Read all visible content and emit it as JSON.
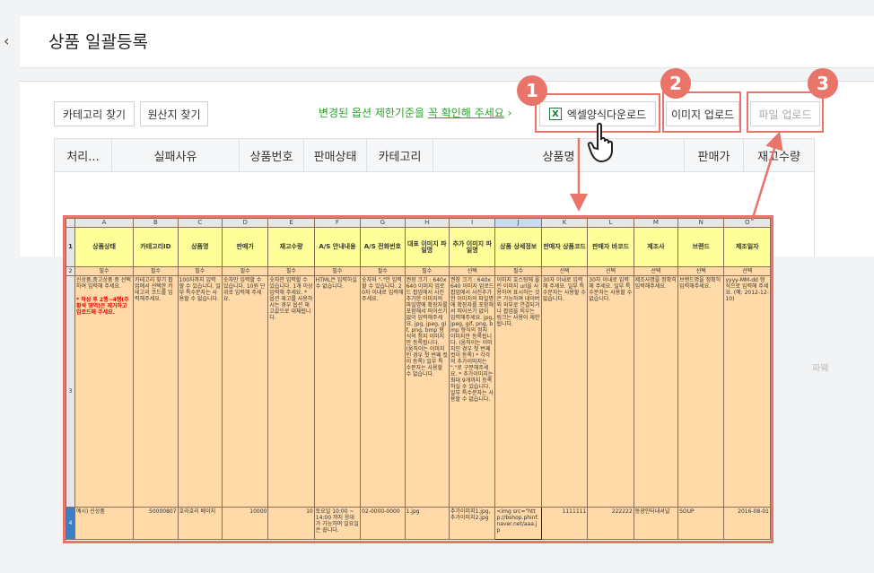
{
  "header": {
    "back_glyph": "‹",
    "title": "상품 일괄등록"
  },
  "toolbar": {
    "category_btn": "카테고리 찾기",
    "origin_btn": "원산지 찾기",
    "notice_pre": "변경된 옵션 제한기준을 ",
    "notice_link": "꼭 확인해 주세요",
    "notice_post": " ›",
    "excel_icon": "X",
    "excel_btn": "엑셀양식다운로드",
    "image_btn": "이미지 업로드",
    "file_btn": "파일 업로드"
  },
  "badges": [
    "1",
    "2",
    "3"
  ],
  "grid": {
    "columns": [
      "처리...",
      "실패사유",
      "상품번호",
      "판매상태",
      "카테고리",
      "상품명",
      "판매가",
      "재고수량"
    ]
  },
  "watermark": "파웨",
  "sheet": {
    "col_letters": [
      "A",
      "B",
      "C",
      "D",
      "E",
      "F",
      "G",
      "H",
      "I",
      "J",
      "K",
      "L",
      "M",
      "N",
      "O"
    ],
    "row_numbers": [
      "1",
      "2",
      "3",
      "4"
    ],
    "headers": [
      "상품상태",
      "카테고리ID",
      "상품명",
      "판매가",
      "재고수량",
      "A/S 안내내용",
      "A/S 전화번호",
      "대표 이미지 파일명",
      "추가 이미지 파일명",
      "상품 상세정보",
      "판매자 상품코드",
      "판매자 바코드",
      "제조사",
      "브랜드",
      "제조일자"
    ],
    "required": [
      "필수",
      "필수",
      "필수",
      "필수",
      "필수",
      "필수",
      "필수",
      "필수",
      "선택",
      "필수",
      "선택",
      "선택",
      "선택",
      "선택",
      "선택"
    ],
    "descriptions": [
      "신상품,중고상품 중 선택하여 입력해 주세요.",
      "카테고리 찾기 팝업에서 선택한 카테고리 코드를 입력해주세요.",
      "100자까지 입력할 수 있습니다. 일부 특수문자는 사용할 수 없습니다.",
      "숫자만 입력할 수 있습니다. 10원 단위로 입력해 주세요.",
      "숫자만 입력할 수 있습니다. 1개 이상 입력해 주세요. * 옵션 재고를 사용하시는 경우 옵션 재고값으로 대체됩니다.",
      "HTML은 입력하실 수 없습니다.",
      "숫자와 \"-\"만 입력할 수 있습니다. 20자 이내로 입력해 주세요.",
      "권장 크기 : 640x640 이미지 업로드 팝업에서 사진추가한 이미지의 파일명에 확장자를 포함해서 띄어쓰기 없이 입력해주세요. jpg, jpeg, gif, png, bmp 형식의 정지 이미지만 등록됩니다. (움직이는 이미지인 경우 첫 번째 컷이 등록) 일부 특수문자는 사용할 수 없습니다.",
      "권장 크기 : 640x640 이미지 업로드 팝업에서 사진추가한 이미지의 파일명에 확장자를 포함해서 띄어쓰기 없이 입력해주세요. jpg, jpeg, gif, png, bmp 형식의 정지 이미지만 등록됩니다. (움직이는 이미지인 경우 첫 번째 컷이 등록) * 각각의 추가이미지는 \",\"로 구분해주세요. * 추가이미지는 최대 9개까지 등록하실 수 있습니다. 일부 특수문자는 사용할 수 없습니다.",
      "이미지 호스팅에 올린 이미지 url을 사용하여 표시하는 것은 가능하며 네이버 외 외부로 연결되거나 팝업을 띄우는 링크는 사용이 제한됩니다.",
      "30자 이내로 입력해 주세요. 일부 특수문자는 사용할 수 없습니다.",
      "30자 이내로 입력해 주세요. 일부 특수문자는 사용할 수 없습니다.",
      "제조사명을 정확히 입력해주세요.",
      "브랜드명을 정확히 입력해주세요.",
      "yyyy-MM-dd 형식으로 입력해 주세요. (예: 2012-12-10)"
    ],
    "desc_red_note": "* 작성 후 2행~4행(주황색 영역)은 제거하고 업로드해 주세요.",
    "examples": [
      "예시) 신상품",
      "50000807",
      "호리호리 베이지",
      "10000",
      "10",
      "토요일 10:00 ~ 14:00 까지 응대가 가능하며 일요일은 쉽니다.",
      "02-0000-0000",
      "1.jpg",
      "추가이미지1.jpg, 추가이미지2.jpg",
      "<img src=\"http://bshop.phinf.naver.net/aaa.jp",
      "1111111",
      "222222",
      "동광인터내셔널",
      "SOUP",
      "2016-08-01"
    ]
  }
}
